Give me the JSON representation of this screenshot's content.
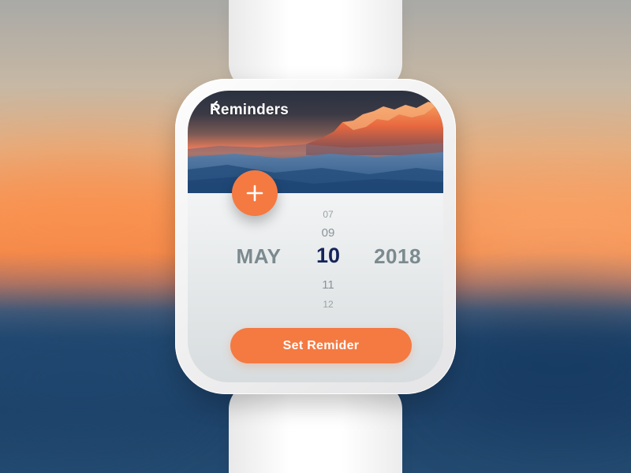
{
  "header": {
    "title": "Reminders",
    "back_icon": "chevron-left-icon"
  },
  "add_button": {
    "icon": "plus-icon"
  },
  "date_picker": {
    "month": "MAY",
    "year": "2018",
    "days_above": [
      "07",
      "09"
    ],
    "selected_day": "10",
    "days_below": [
      "11",
      "12"
    ]
  },
  "action": {
    "set_label": "Set Remider"
  },
  "colors": {
    "accent": "#f47a42",
    "selected_day": "#16245a",
    "muted_text": "#7b8a8f"
  }
}
